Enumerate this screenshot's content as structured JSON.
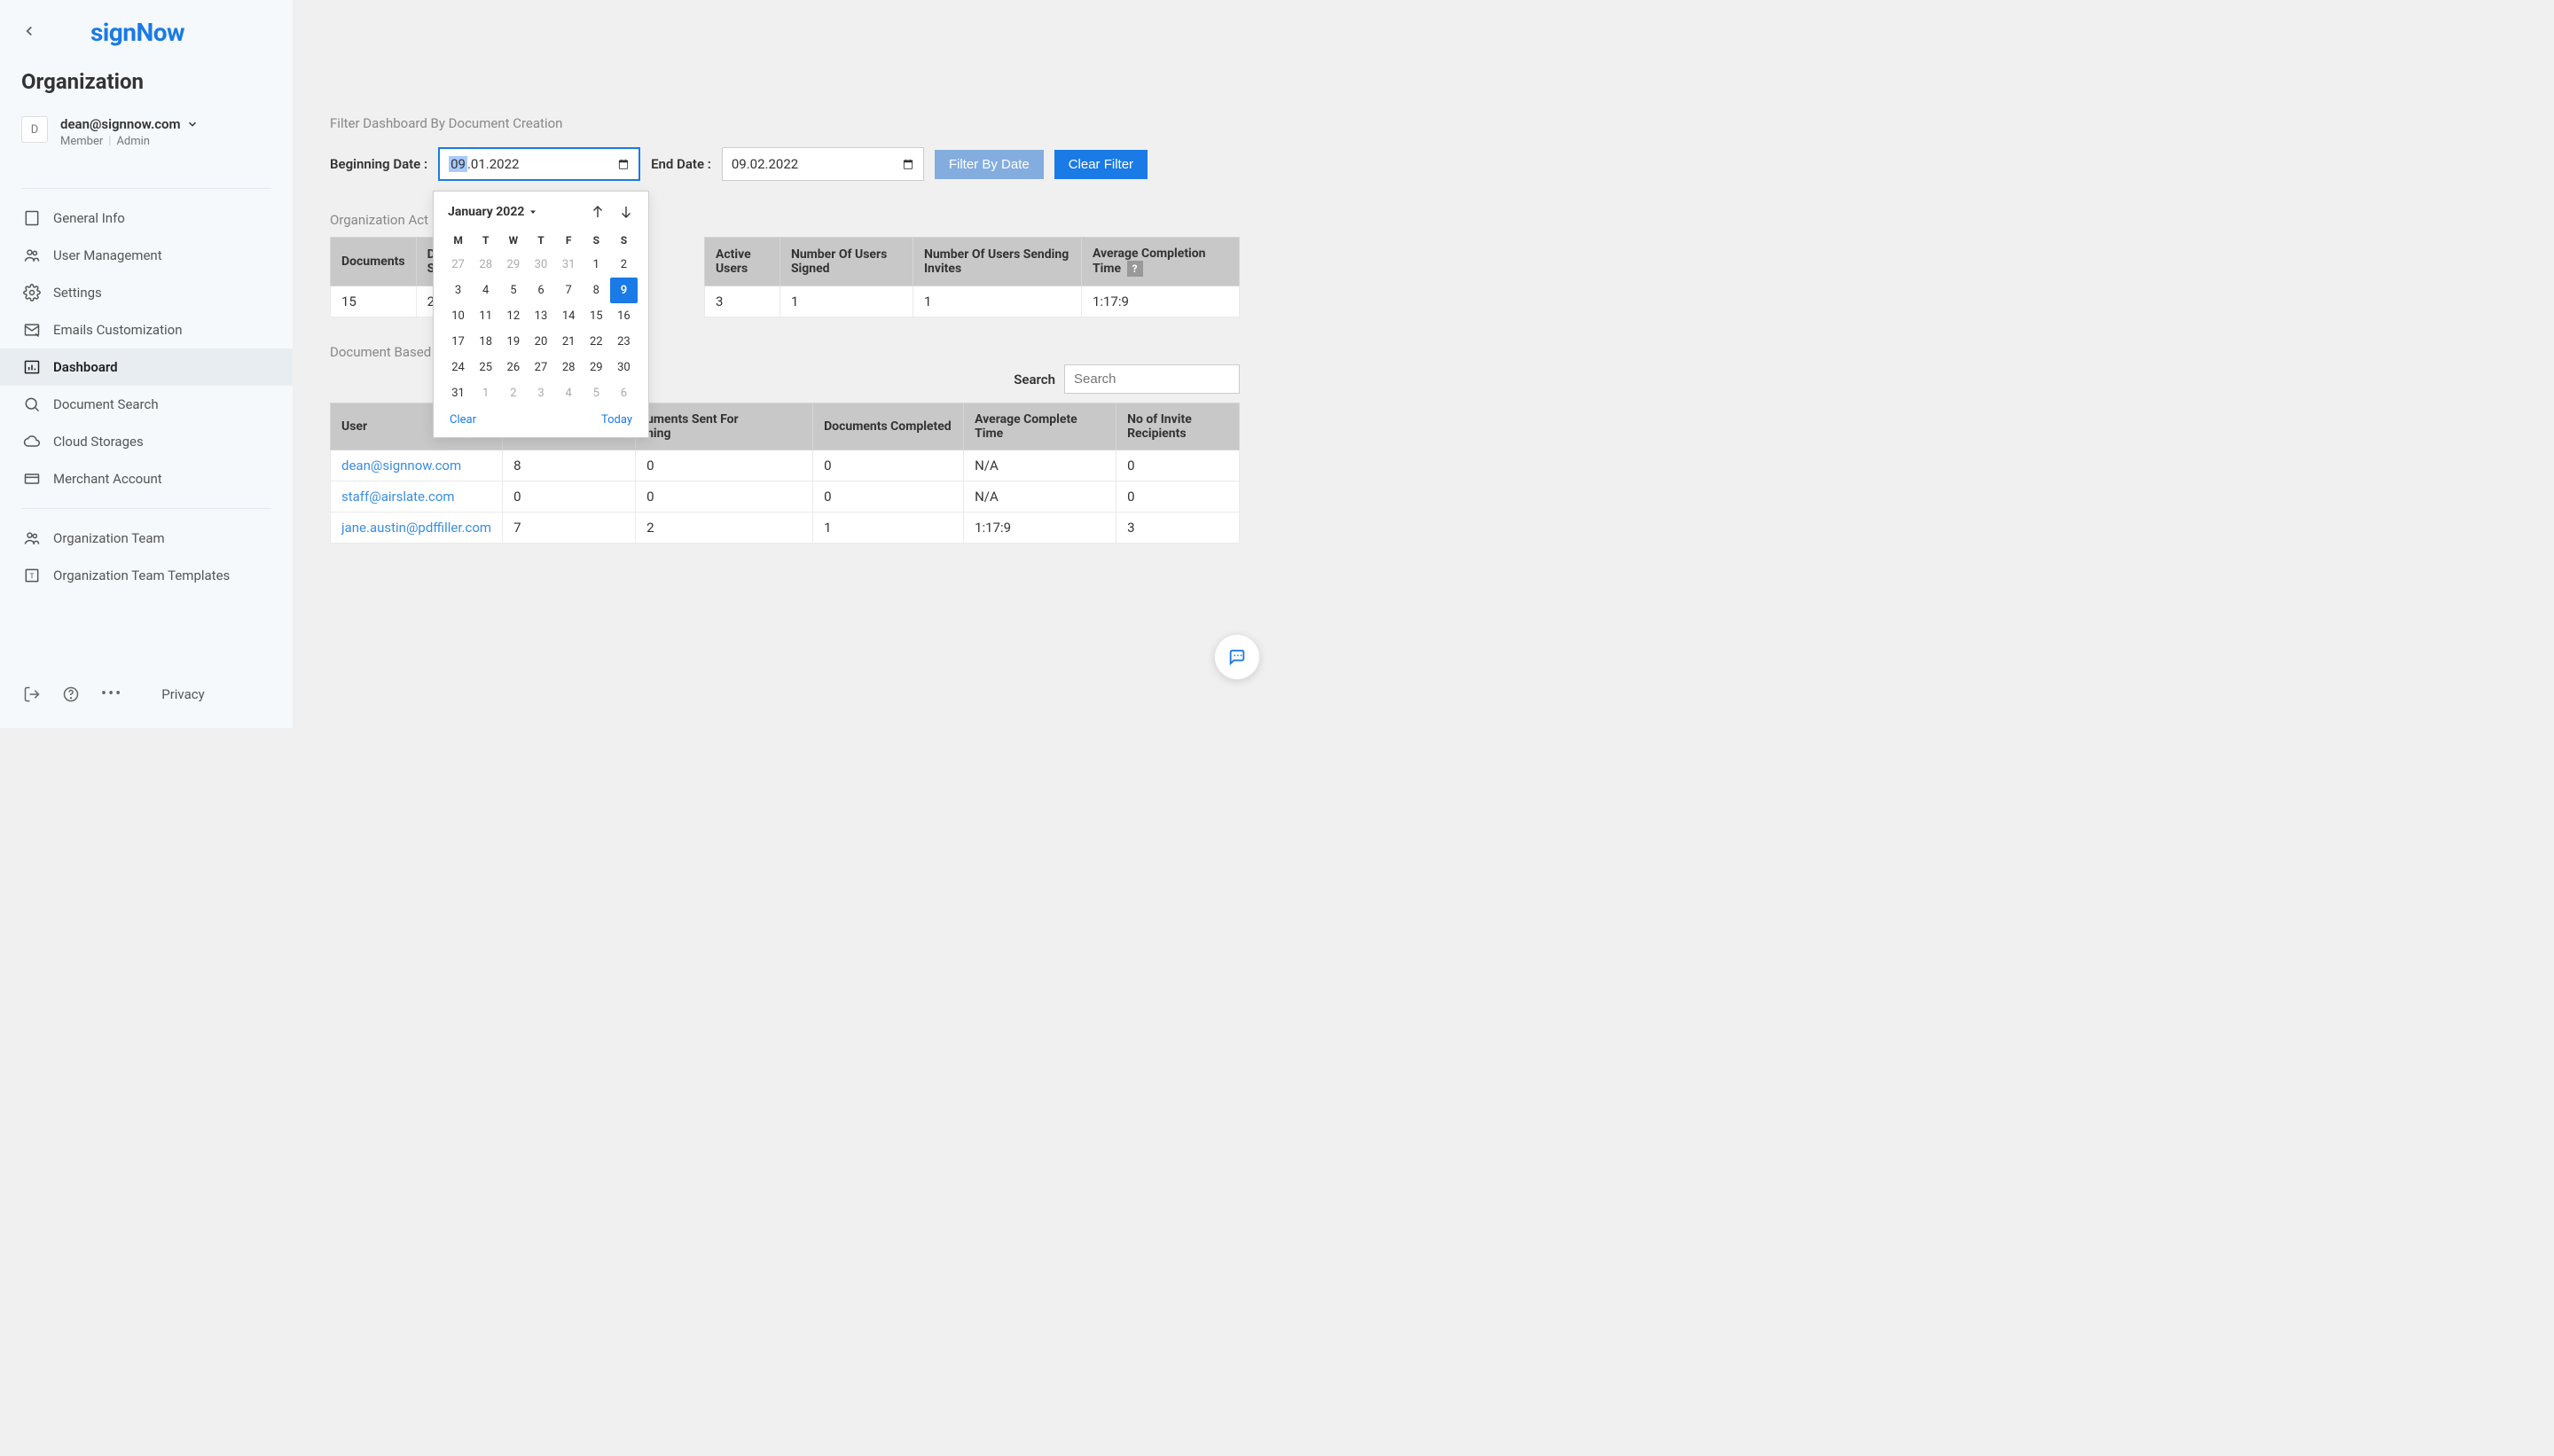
{
  "sidebar": {
    "logo": "signNow",
    "org_title": "Organization",
    "user": {
      "avatar_letter": "D",
      "email": "dean@signnow.com",
      "role1": "Member",
      "role2": "Admin"
    },
    "nav": {
      "general_info": "General Info",
      "user_management": "User Management",
      "settings": "Settings",
      "emails_customization": "Emails Customization",
      "dashboard": "Dashboard",
      "document_search": "Document Search",
      "cloud_storages": "Cloud Storages",
      "merchant_account": "Merchant Account",
      "org_team": "Organization Team",
      "org_team_templates": "Organization Team Templates"
    },
    "footer": {
      "privacy": "Privacy"
    }
  },
  "filter": {
    "heading": "Filter Dashboard By Document Creation",
    "beginning_label": "Beginning Date :",
    "beginning_value_selected": "09",
    "beginning_value_rest": ".01.2022",
    "end_label": "End Date :",
    "end_value": "09.02.2022",
    "filter_btn": "Filter By Date",
    "clear_btn": "Clear Filter"
  },
  "datepicker": {
    "month_label": "January 2022",
    "dow": [
      "M",
      "T",
      "W",
      "T",
      "F",
      "S",
      "S"
    ],
    "rows": [
      [
        {
          "d": "27",
          "m": true
        },
        {
          "d": "28",
          "m": true
        },
        {
          "d": "29",
          "m": true
        },
        {
          "d": "30",
          "m": true
        },
        {
          "d": "31",
          "m": true
        },
        {
          "d": "1"
        },
        {
          "d": "2"
        }
      ],
      [
        {
          "d": "3"
        },
        {
          "d": "4"
        },
        {
          "d": "5"
        },
        {
          "d": "6"
        },
        {
          "d": "7"
        },
        {
          "d": "8"
        },
        {
          "d": "9",
          "sel": true
        }
      ],
      [
        {
          "d": "10"
        },
        {
          "d": "11"
        },
        {
          "d": "12"
        },
        {
          "d": "13"
        },
        {
          "d": "14"
        },
        {
          "d": "15"
        },
        {
          "d": "16"
        }
      ],
      [
        {
          "d": "17"
        },
        {
          "d": "18"
        },
        {
          "d": "19"
        },
        {
          "d": "20"
        },
        {
          "d": "21"
        },
        {
          "d": "22"
        },
        {
          "d": "23"
        }
      ],
      [
        {
          "d": "24"
        },
        {
          "d": "25"
        },
        {
          "d": "26"
        },
        {
          "d": "27"
        },
        {
          "d": "28"
        },
        {
          "d": "29"
        },
        {
          "d": "30"
        }
      ],
      [
        {
          "d": "31"
        },
        {
          "d": "1",
          "m": true
        },
        {
          "d": "2",
          "m": true
        },
        {
          "d": "3",
          "m": true
        },
        {
          "d": "4",
          "m": true
        },
        {
          "d": "5",
          "m": true
        },
        {
          "d": "6",
          "m": true
        }
      ]
    ],
    "clear": "Clear",
    "today": "Today"
  },
  "activity_table": {
    "title": "Organization Act",
    "headers": {
      "documents": "Documents",
      "docs_signed": "Do\nSig",
      "active_users": "Active Users",
      "num_signed": "Number Of Users Signed",
      "num_invites": "Number Of Users Sending Invites",
      "avg_time": "Average Completion Time",
      "help": "?"
    },
    "row": {
      "documents": "15",
      "docs_signed": "2",
      "active_users": "3",
      "num_signed": "1",
      "num_invites": "1",
      "avg_time": "1:17:9"
    }
  },
  "doc_table": {
    "title": "Document Based",
    "search_label": "Search",
    "search_placeholder": "Search",
    "headers": {
      "user": "User",
      "col2": "",
      "sent": "uments Sent For\nning",
      "completed": "Documents Completed",
      "avg": "Average Complete Time",
      "recipients": "No of Invite Recipients"
    },
    "rows": [
      {
        "user": "dean@signnow.com",
        "c2": "8",
        "sent": "0",
        "completed": "0",
        "avg": "N/A",
        "recipients": "0"
      },
      {
        "user": "staff@airslate.com",
        "c2": "0",
        "sent": "0",
        "completed": "0",
        "avg": "N/A",
        "recipients": "0"
      },
      {
        "user": "jane.austin@pdffiller.com",
        "c2": "7",
        "sent": "2",
        "completed": "1",
        "avg": "1:17:9",
        "recipients": "3"
      }
    ]
  }
}
